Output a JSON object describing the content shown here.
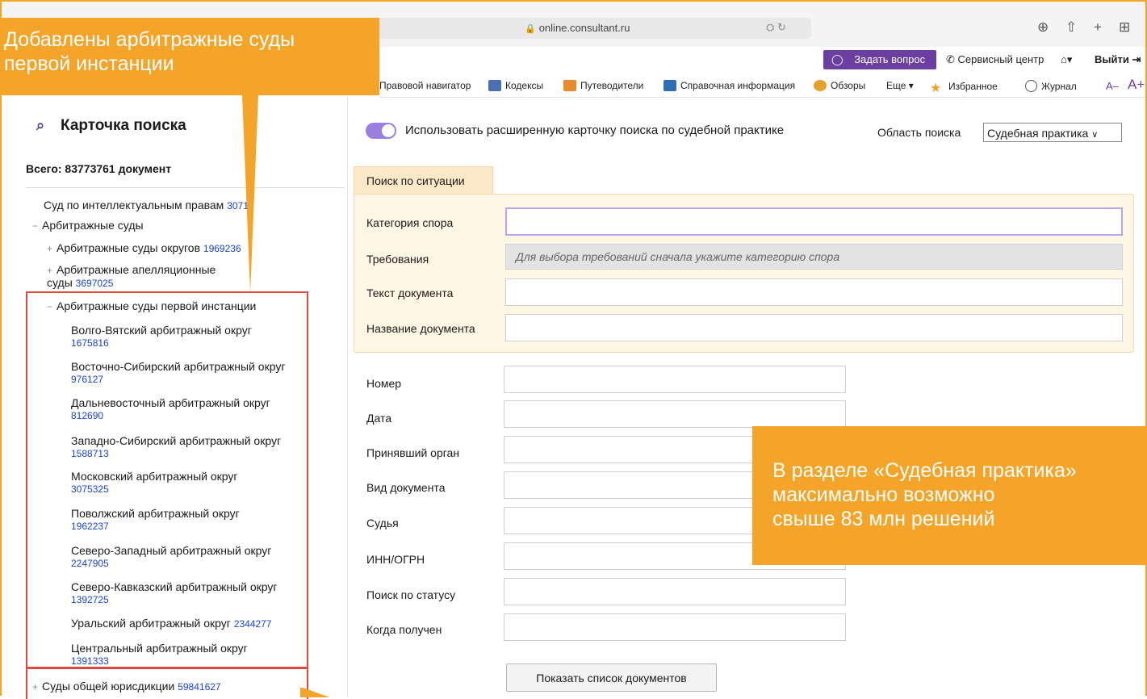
{
  "browser": {
    "url": "online.consultant.ru"
  },
  "service": {
    "ask_question": "Задать вопрос",
    "service_center": "Сервисный центр",
    "logout": "Выйти"
  },
  "toolbar": {
    "legal_navigator": "Правовой навигатор",
    "codes": "Кодексы",
    "guides": "Путеводители",
    "reference": "Справочная информация",
    "reviews": "Обзоры",
    "more": "Еще ▾",
    "favorites": "Избранное",
    "journal": "Журнал",
    "font_smaller": "A–",
    "font_larger": "A+"
  },
  "sidebar": {
    "title": "Карточка поиска",
    "total": "Всего: 83773761 документ",
    "items": [
      {
        "label": "Суд по интеллектуальным правам",
        "count": "30712"
      },
      {
        "label": "Арбитражные суды",
        "count": ""
      },
      {
        "label": "Арбитражные суды округов",
        "count": "1969236"
      },
      {
        "label": "Арбитражные апелляционные суды",
        "count": "3697025"
      },
      {
        "label": "Арбитражные суды первой инстанции",
        "count": ""
      },
      {
        "label": "Волго-Вятский арбитражный округ",
        "count": "1675816"
      },
      {
        "label": "Восточно-Сибирский арбитражный округ",
        "count": "976127"
      },
      {
        "label": "Дальневосточный арбитражный округ",
        "count": "812690"
      },
      {
        "label": "Западно-Сибирский арбитражный округ",
        "count": "1588713"
      },
      {
        "label": "Московский арбитражный округ",
        "count": "3075325"
      },
      {
        "label": "Поволжский арбитражный округ",
        "count": "1962237"
      },
      {
        "label": "Северо-Западный арбитражный округ",
        "count": "2247905"
      },
      {
        "label": "Северо-Кавказский арбитражный округ",
        "count": "1392725"
      },
      {
        "label": "Уральский арбитражный округ",
        "count": "2344277"
      },
      {
        "label": "Центральный арбитражный округ",
        "count": "1391333"
      },
      {
        "label": "Суды общей юрисдикции",
        "count": "59841627"
      }
    ]
  },
  "main": {
    "toggle_label": "Использовать расширенную карточку поиска по судебной практике",
    "area_label": "Область поиска",
    "area_value": "Судебная практика",
    "tab_label": "Поиск по ситуации",
    "situation_fields": {
      "category": "Категория спора",
      "requirements": "Требования",
      "requirements_placeholder": "Для выбора требований сначала укажите категорию спора",
      "doc_text": "Текст документа",
      "doc_name": "Название документа"
    },
    "fields": {
      "number": "Номер",
      "date": "Дата",
      "body": "Принявший орган",
      "doc_type": "Вид документа",
      "judge": "Судья",
      "inn": "ИНН/ОГРН",
      "status_search": "Поиск по статусу",
      "received": "Когда получен"
    },
    "show_button": "Показать список документов"
  },
  "callouts": {
    "top_left_line1": "Добавлены арбитражные суды",
    "top_left_line2": "первой инстанции",
    "right_line1": "В разделе «Судебная практика»",
    "right_line2": "максимально возможно",
    "right_line3": "свыше 83 млн решений"
  },
  "colors": {
    "accent_orange": "#f5a42a",
    "brand_purple": "#6a3fa0",
    "highlight_red": "#e04a3a",
    "count_blue": "#1a43d8"
  }
}
